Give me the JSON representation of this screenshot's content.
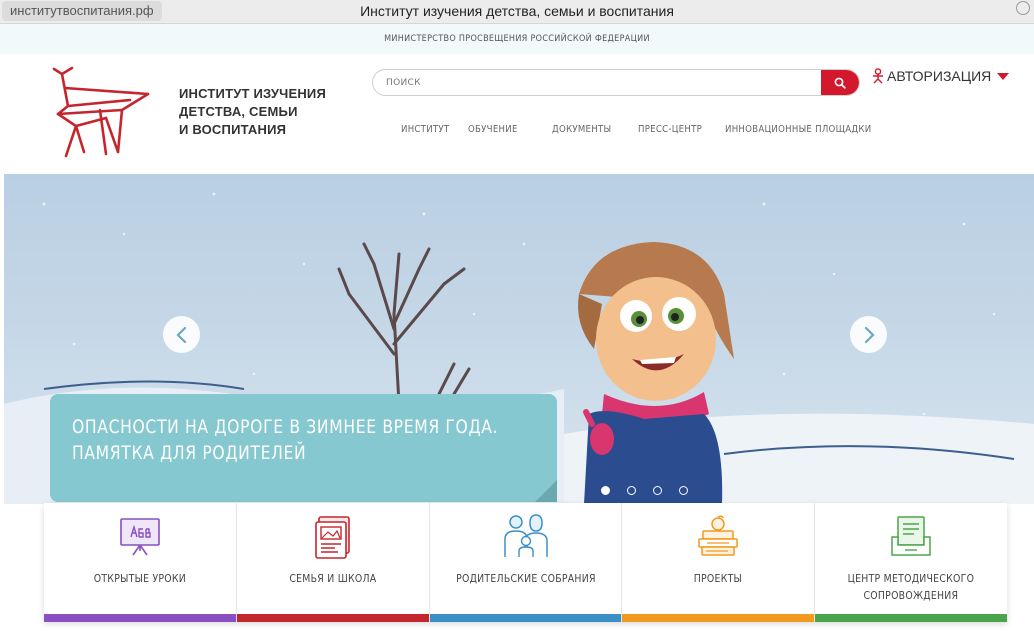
{
  "browser": {
    "url": "институтвоспитания.рф",
    "title": "Институт изучения детства, семьи и воспитания"
  },
  "ministry": "МИНИСТЕРСТВО ПРОСВЕЩЕНИЯ РОССИЙСКОЙ ФЕДЕРАЦИИ",
  "logo": {
    "line1": "ИНСТИТУТ ИЗУЧЕНИЯ",
    "line2": "ДЕТСТВА, СЕМЬИ",
    "line3": "И ВОСПИТАНИЯ",
    "icon": "chair-logo-icon",
    "color": "#c4262e"
  },
  "search": {
    "placeholder": "ПОИСК",
    "icon": "search-icon"
  },
  "auth": {
    "label": "АВТОРИЗАЦИЯ",
    "icon": "person-icon"
  },
  "nav": [
    "ИНСТИТУТ",
    "ОБУЧЕНИЕ",
    "ДОКУМЕНТЫ",
    "ПРЕСС-ЦЕНТР",
    "ИННОВАЦИОННЫЕ ПЛОЩАДКИ"
  ],
  "hero": {
    "caption_line1": "ОПАСНОСТИ НА ДОРОГЕ В ЗИМНЕЕ ВРЕМЯ ГОДА.",
    "caption_line2": "ПАМЯТКА ДЛЯ РОДИТЕЛЕЙ",
    "slide_count": 4,
    "active_slide": 1
  },
  "tiles": [
    {
      "label": "ОТКРЫТЫЕ УРОКИ",
      "color": "#8a4fc1",
      "icon": "blackboard-icon"
    },
    {
      "label": "СЕМЬЯ И ШКОЛА",
      "color": "#c4262e",
      "icon": "newspaper-icon"
    },
    {
      "label": "РОДИТЕЛЬСКИЕ СОБРАНИЯ",
      "color": "#3a8fc7",
      "icon": "family-icon"
    },
    {
      "label": "ПРОЕКТЫ",
      "color": "#f29a1f",
      "icon": "books-apple-icon"
    },
    {
      "label": "ЦЕНТР МЕТОДИЧЕСКОГО\nСОПРОВОЖДЕНИЯ",
      "color": "#4aa54a",
      "icon": "document-tray-icon"
    }
  ],
  "colors": {
    "accent": "#d3182d",
    "caption_bg": "#86c8cf"
  }
}
